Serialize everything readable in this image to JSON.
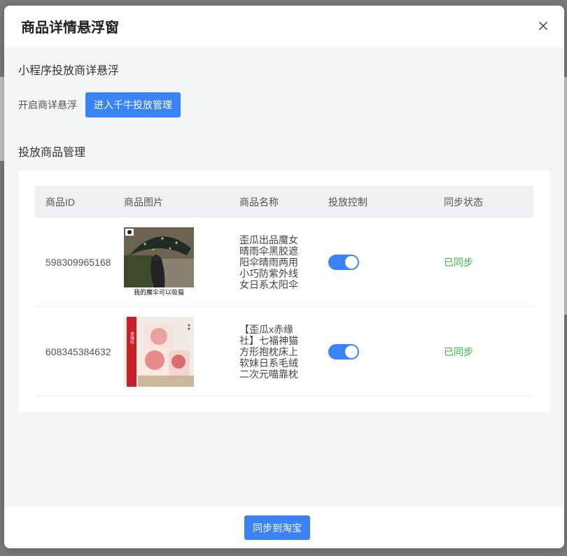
{
  "modal": {
    "title": "商品详情悬浮窗",
    "close_icon": "close-icon"
  },
  "section1": {
    "title": "小程序投放商详悬浮",
    "enable_label": "开启商详悬浮",
    "manage_button": "进入千牛投放管理"
  },
  "section2": {
    "title": "投放商品管理"
  },
  "table": {
    "headers": [
      "商品ID",
      "商品图片",
      "商品名称",
      "投放控制",
      "同步状态"
    ],
    "rows": [
      {
        "id": "598309965168",
        "image_caption": "我的魔伞可以吸猫",
        "name": "歪瓜出品魔女晴雨伞黑胶遮阳伞晴雨两用小巧防紫外线女日系太阳伞",
        "control_on": true,
        "status": "已同步"
      },
      {
        "id": "608345384632",
        "image_caption": "赤缘社",
        "name": "【歪瓜x赤缘社】七福神猫方形抱枕床上软妹日系毛绒二次元喵靠枕",
        "control_on": true,
        "status": "已同步"
      }
    ]
  },
  "footer": {
    "sync_button": "同步到淘宝"
  },
  "colors": {
    "primary": "#3a83f7",
    "success": "#2fb83b",
    "header_bg": "#eef0f4"
  }
}
